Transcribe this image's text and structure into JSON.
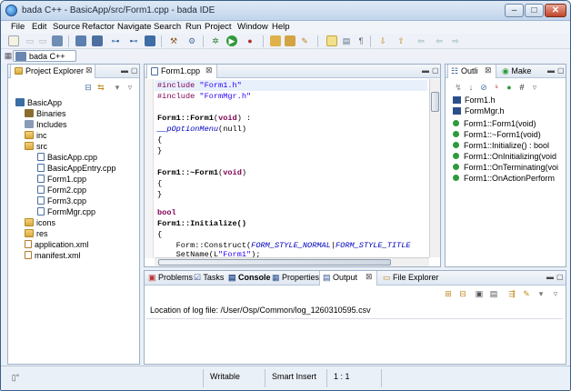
{
  "window": {
    "title": "bada C++ - BasicApp/src/Form1.cpp - bada IDE"
  },
  "menu": [
    "File",
    "Edit",
    "Source",
    "Refactor",
    "Navigate",
    "Search",
    "Run",
    "Project",
    "Window",
    "Help"
  ],
  "perspective": {
    "label": "bada C++"
  },
  "project_explorer": {
    "tab_label": "Project Explorer",
    "items": [
      {
        "label": "BasicApp",
        "icon": "project-icon",
        "indent": 0
      },
      {
        "label": "Binaries",
        "icon": "binaries-icon",
        "indent": 1
      },
      {
        "label": "Includes",
        "icon": "includes-icon",
        "indent": 1
      },
      {
        "label": "inc",
        "icon": "folder-icon",
        "indent": 1
      },
      {
        "label": "src",
        "icon": "folder-icon",
        "indent": 1
      },
      {
        "label": "BasicApp.cpp",
        "icon": "cpp-file-icon",
        "indent": 2
      },
      {
        "label": "BasicAppEntry.cpp",
        "icon": "cpp-file-icon",
        "indent": 2
      },
      {
        "label": "Form1.cpp",
        "icon": "cpp-file-icon",
        "indent": 2
      },
      {
        "label": "Form2.cpp",
        "icon": "cpp-file-icon",
        "indent": 2
      },
      {
        "label": "Form3.cpp",
        "icon": "cpp-file-icon",
        "indent": 2
      },
      {
        "label": "FormMgr.cpp",
        "icon": "cpp-file-icon",
        "indent": 2
      },
      {
        "label": "icons",
        "icon": "folder-icon",
        "indent": 1
      },
      {
        "label": "res",
        "icon": "folder-icon",
        "indent": 1
      },
      {
        "label": "application.xml",
        "icon": "xml-file-icon",
        "indent": 1
      },
      {
        "label": "manifest.xml",
        "icon": "xml-file-icon",
        "indent": 1
      }
    ]
  },
  "editor": {
    "tab_label": "Form1.cpp",
    "lines": [
      "#include \"Form1.h\"",
      "#include \"FormMgr.h\"",
      "",
      "Form1::Form1(void) :",
      "__pOptionMenu(null)",
      "{",
      "}",
      "",
      "",
      "Form1::~Form1(void)",
      "{",
      "}",
      "",
      "",
      "bool",
      "Form1::Initialize()",
      "{",
      "    Form::Construct(FORM_STYLE_NORMAL|FORM_STYLE_TITLE",
      "    SetName(L\"Form1\");"
    ]
  },
  "outline": {
    "tabs": [
      "Outli",
      "Make"
    ],
    "items": [
      {
        "label": "Form1.h",
        "icon": "header-include-icon"
      },
      {
        "label": "FormMgr.h",
        "icon": "header-include-icon"
      },
      {
        "label": "Form1::Form1(void)",
        "icon": "public-method-icon"
      },
      {
        "label": "Form1::~Form1(void)",
        "icon": "public-method-icon"
      },
      {
        "label": "Form1::Initialize() : bool",
        "icon": "public-method-icon"
      },
      {
        "label": "Form1::OnInitializing(void",
        "icon": "public-method-icon"
      },
      {
        "label": "Form1::OnTerminating(voi",
        "icon": "public-method-icon"
      },
      {
        "label": "Form1::OnActionPerform",
        "icon": "public-method-icon"
      }
    ]
  },
  "bottom_panel": {
    "tabs": [
      "Problems",
      "Tasks",
      "Console",
      "Properties",
      "Output",
      "File Explorer"
    ],
    "active_tab": "Output",
    "console_line": "Location of log file: /User/Osp/Common/log_1260310595.csv"
  },
  "status_bar": {
    "writable": "Writable",
    "insert_mode": "Smart Insert",
    "position": "1 : 1"
  }
}
